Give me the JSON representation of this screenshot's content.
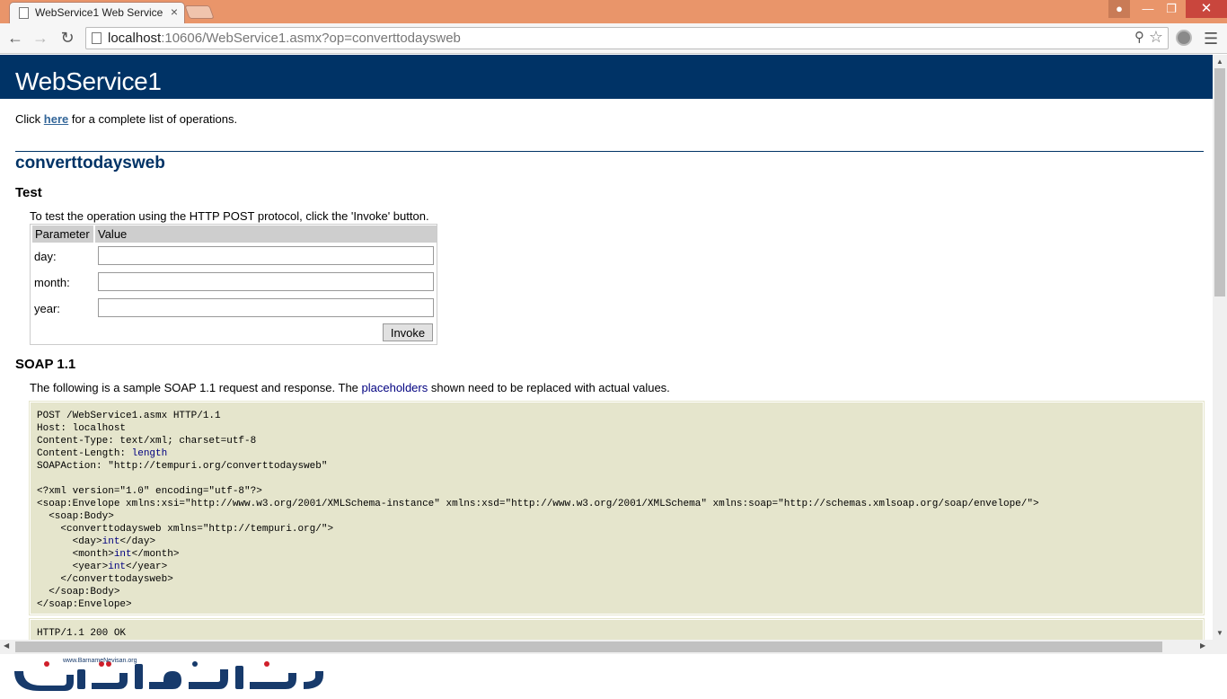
{
  "browser": {
    "tab_title": "WebService1 Web Service",
    "url_host": "localhost",
    "url_rest": ":10606/WebService1.asmx?op=converttodaysweb"
  },
  "page": {
    "heading": "WebService1",
    "intro_prefix": "Click ",
    "intro_link": "here",
    "intro_suffix": " for a complete list of operations.",
    "operation": "converttodaysweb",
    "test_heading": "Test",
    "test_intro": "To test the operation using the HTTP POST protocol, click the 'Invoke' button.",
    "table": {
      "col_parameter": "Parameter",
      "col_value": "Value",
      "params": [
        {
          "label": "day:",
          "value": ""
        },
        {
          "label": "month:",
          "value": ""
        },
        {
          "label": "year:",
          "value": ""
        }
      ],
      "invoke_label": "Invoke"
    },
    "soap_heading": "SOAP 1.1",
    "soap_intro_prefix": "The following is a sample SOAP 1.1 request and response. The ",
    "soap_intro_link": "placeholders",
    "soap_intro_suffix": " shown need to be replaced with actual values.",
    "request_lines": [
      "POST /WebService1.asmx HTTP/1.1",
      "Host: localhost",
      "Content-Type: text/xml; charset=utf-8",
      "Content-Length: ",
      "SOAPAction: \"http://tempuri.org/converttodaysweb\"",
      "",
      "<?xml version=\"1.0\" encoding=\"utf-8\"?>",
      "<soap:Envelope xmlns:xsi=\"http://www.w3.org/2001/XMLSchema-instance\" xmlns:xsd=\"http://www.w3.org/2001/XMLSchema\" xmlns:soap=\"http://schemas.xmlsoap.org/soap/envelope/\">",
      "  <soap:Body>",
      "    <converttodaysweb xmlns=\"http://tempuri.org/\">",
      "      <day>",
      "      <month>",
      "      <year>",
      "    </converttodaysweb>",
      "  </soap:Body>",
      "</soap:Envelope>"
    ],
    "placeholder_length": "length",
    "placeholder_int": "int",
    "close_day": "</day>",
    "close_month": "</month>",
    "close_year": "</year>",
    "response_line": "HTTP/1.1 200 OK"
  },
  "logo_text": "www.BarnameNevisan.org",
  "colors": {
    "header_bg": "#003366",
    "code_bg": "#e5e5cc",
    "title_bar": "#e9956a"
  }
}
